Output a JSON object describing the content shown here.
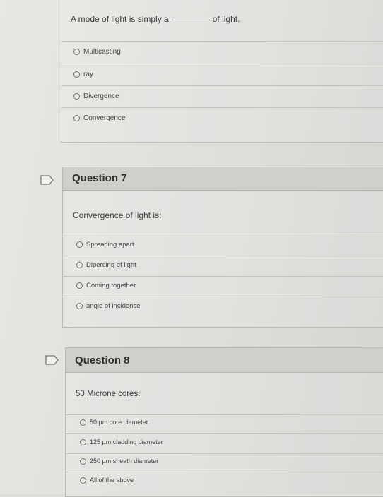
{
  "q6": {
    "prompt_before": "A mode of light is simply a",
    "prompt_after": "of light.",
    "options": [
      "Multicasting",
      "ray",
      "Divergence",
      "Convergence"
    ]
  },
  "q7": {
    "title": "Question 7",
    "prompt": "Convergence of light is:",
    "options": [
      "Spreading apart",
      "Dipercing of light",
      "Coming together",
      "angle of incidence"
    ]
  },
  "q8": {
    "title": "Question 8",
    "prompt": "50 Microne cores:",
    "options": [
      "50 µm core diameter",
      "125 µm cladding diameter",
      "250 µm sheath diameter",
      "All of the above"
    ]
  },
  "icons": {
    "flag": "flag-icon"
  }
}
